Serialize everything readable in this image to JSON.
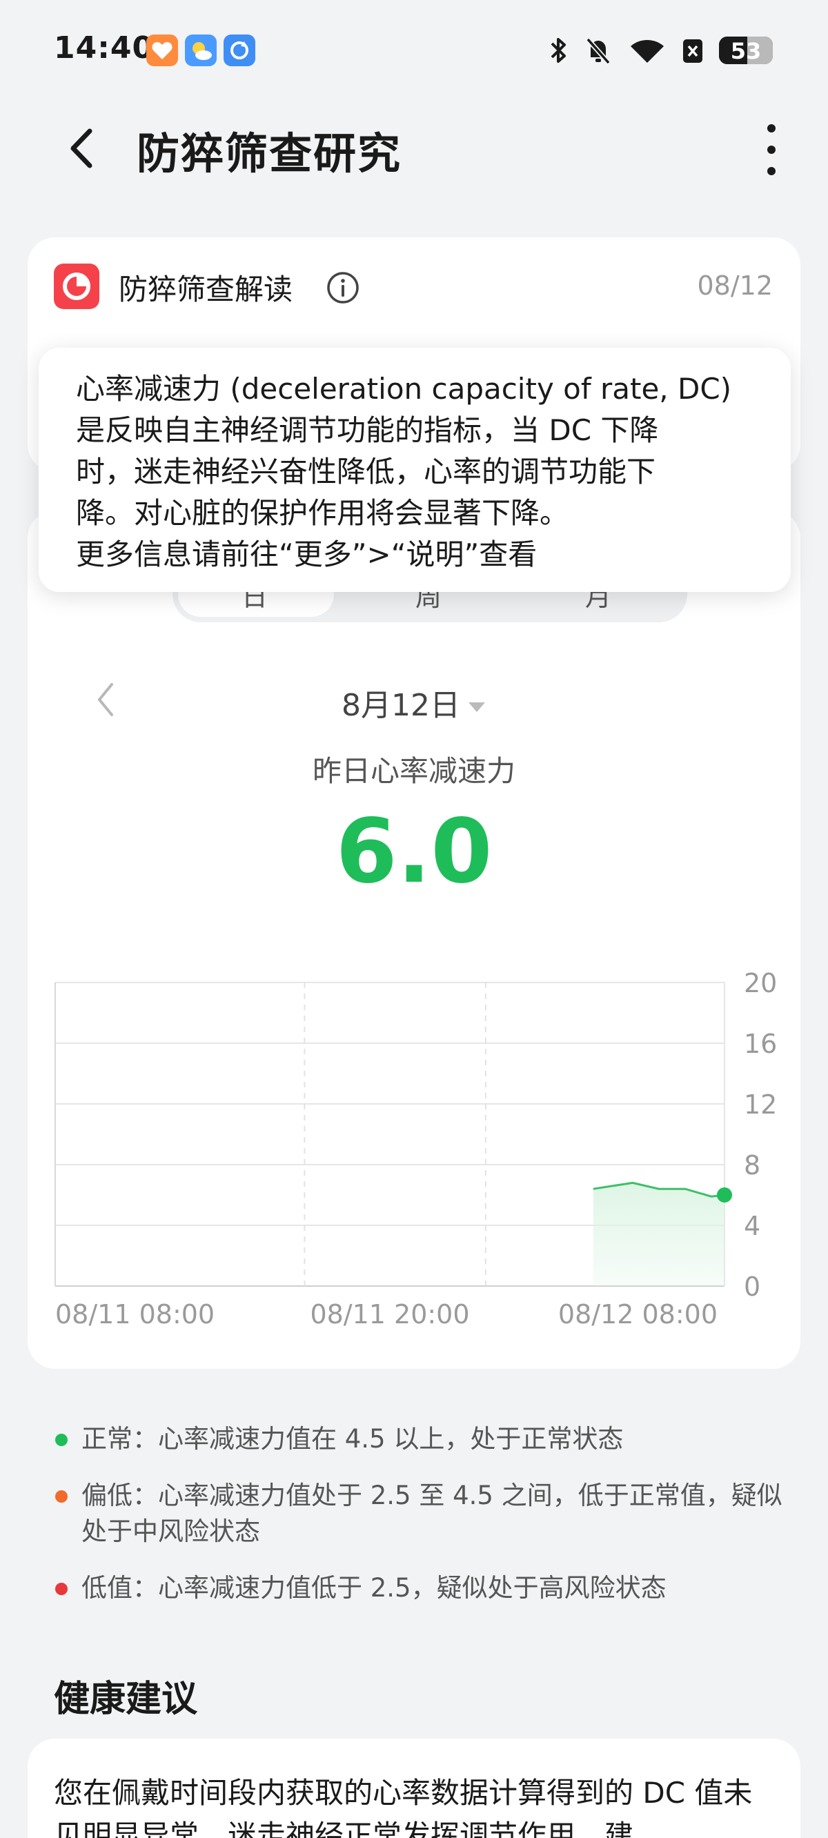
{
  "status_bar": {
    "time": "14:40",
    "battery": "53"
  },
  "header": {
    "title": "防猝筛查研究"
  },
  "interpretation": {
    "title": "防猝筛查解读",
    "date": "08/12"
  },
  "tooltip": {
    "lines": [
      "心率减速力 (deceleration capacity of rate, DC)",
      "是反映自主神经调节功能的指标，当 DC 下降",
      "时，迷走神经兴奋性降低，心率的调节功能下",
      "降。对心脏的保护作用将会显著下降。",
      "更多信息请前往“更多”>“说明”查看"
    ]
  },
  "tabs": [
    "日",
    "周",
    "月"
  ],
  "date_selector": {
    "label": "8月12日"
  },
  "metric": {
    "label": "昨日心率减速力",
    "value": "6.0"
  },
  "chart_data": {
    "type": "area",
    "title": "",
    "xlabel": "",
    "ylabel": "",
    "x_ticks": [
      "08/11 08:00",
      "08/11 20:00",
      "08/12 08:00"
    ],
    "y_ticks": [
      0,
      4,
      8,
      12,
      16,
      20
    ],
    "ylim": [
      0,
      20
    ],
    "xlim_hours": [
      0,
      25.5
    ],
    "grid": true,
    "series": [
      {
        "x_hours": [
          20.5,
          22.0,
          23.0,
          24.0,
          25.0,
          25.5
        ],
        "values": [
          6.4,
          6.8,
          6.4,
          6.4,
          5.9,
          6.0
        ]
      }
    ],
    "colors": {
      "line": "#3cc067",
      "fill": "#dff5e6",
      "marker": "#1fbd5a"
    }
  },
  "legend": [
    {
      "text": "正常：心率减速力值在 4.5 以上，处于正常状态",
      "color": "#1fbd5a"
    },
    {
      "text": "偏低：心率减速力值处于 2.5 至 4.5 之间，低于正常值，疑似处于中风险状态",
      "color": "#f26b2a"
    },
    {
      "text": "低值：心率减速力值低于 2.5，疑似处于高风险状态",
      "color": "#e8383b"
    }
  ],
  "advice": {
    "section_title": "健康建议",
    "text": "您在佩戴时间段内获取的心率数据计算得到的 DC 值未见明显异常，迷走神经正常发挥调节作用，建"
  }
}
